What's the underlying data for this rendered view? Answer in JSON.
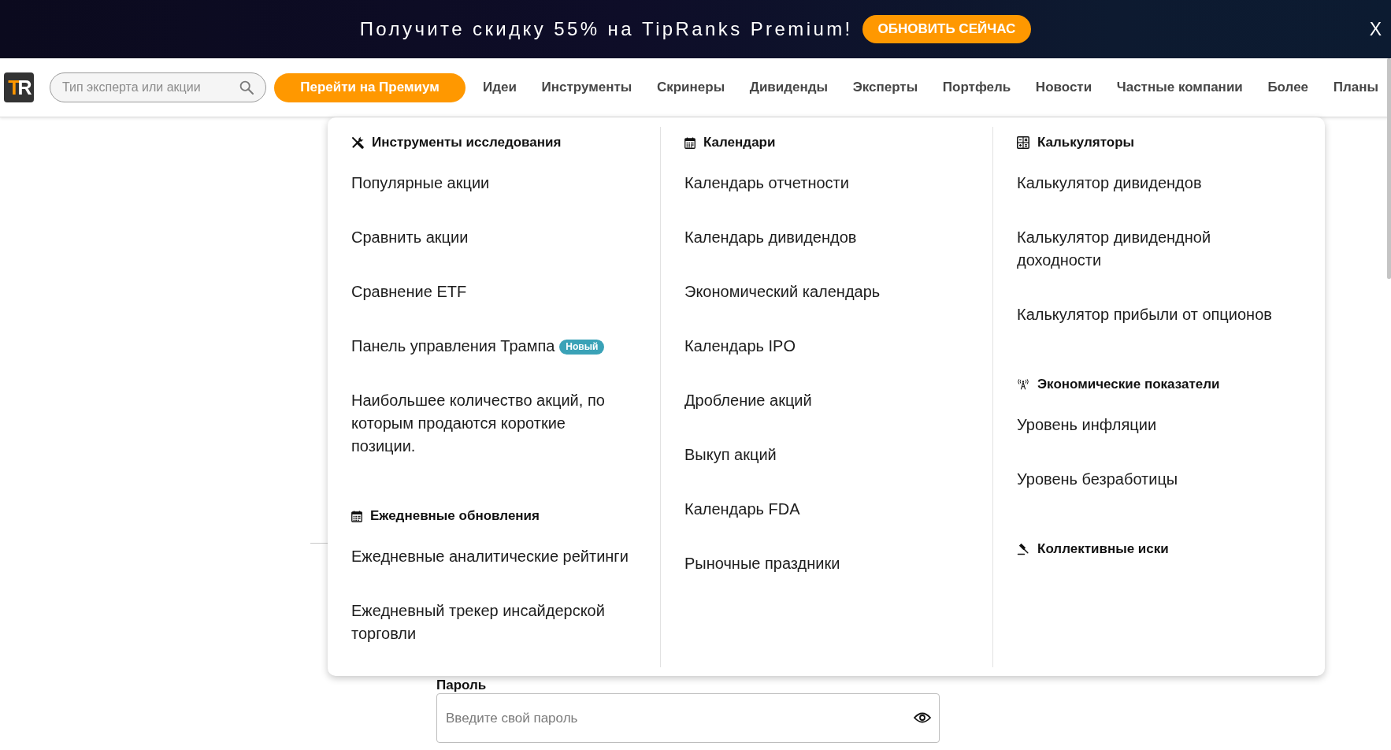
{
  "promo_banner": {
    "text": "Получите скидку 55% на TipRanks Premium!",
    "button": "ОБНОВИТЬ СЕЙЧАС",
    "close": "X"
  },
  "navbar": {
    "logo": "TR",
    "search": {
      "placeholder": "Тип эксперта или акции"
    },
    "premium_button": "Перейти на Премиум",
    "links": [
      "Идеи",
      "Инструменты",
      "Скринеры",
      "Дивиденды",
      "Эксперты",
      "Портфель",
      "Новости",
      "Частные компании",
      "Более",
      "Планы"
    ]
  },
  "dropdown": {
    "columns": [
      {
        "groups": [
          {
            "title": "Инструменты исследования",
            "kind": "tools",
            "items": [
              {
                "label": "Популярные акции"
              },
              {
                "label": "Сравнить акции"
              },
              {
                "label": "Сравнение ETF"
              },
              {
                "label": "Панель управления Трампа",
                "badge": "Новый"
              },
              {
                "label": "Наибольшее количество акций, по которым продаются короткие позиции."
              }
            ]
          },
          {
            "title": "Ежедневные обновления",
            "kind": "calendar",
            "items": [
              {
                "label": "Ежедневные аналитические рейтинги"
              },
              {
                "label": "Ежедневный трекер инсайдерской торговли"
              }
            ]
          }
        ]
      },
      {
        "groups": [
          {
            "title": "Календари",
            "kind": "calendar",
            "items": [
              {
                "label": "Календарь отчетности"
              },
              {
                "label": "Календарь дивидендов"
              },
              {
                "label": "Экономический календарь"
              },
              {
                "label": "Календарь IPO"
              },
              {
                "label": "Дробление акций"
              },
              {
                "label": "Выкуп акций"
              },
              {
                "label": "Календарь FDA"
              },
              {
                "label": "Рыночные праздники"
              }
            ]
          }
        ]
      },
      {
        "groups": [
          {
            "title": "Калькуляторы",
            "kind": "calculator",
            "items": [
              {
                "label": "Калькулятор дивидендов"
              },
              {
                "label": "Калькулятор дивидендной доходности"
              },
              {
                "label": "Калькулятор прибыли от опционов"
              }
            ]
          },
          {
            "title": "Экономические показатели",
            "kind": "antenna",
            "items": [
              {
                "label": "Уровень инфляции"
              },
              {
                "label": "Уровень безработицы"
              }
            ]
          },
          {
            "title": "Коллективные иски",
            "kind": "gavel"
          }
        ]
      }
    ]
  },
  "login_form": {
    "password": {
      "label": "Пароль",
      "placeholder": "Введите свой пароль"
    }
  }
}
